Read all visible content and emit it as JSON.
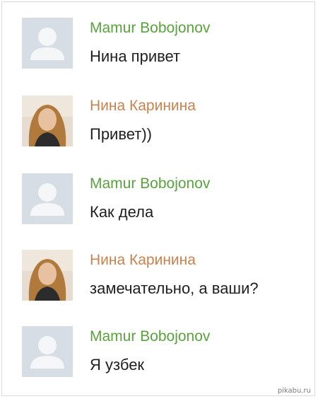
{
  "colors": {
    "name_male": "#58a33c",
    "name_female": "#c9824f",
    "text": "#1f1f1f",
    "avatar_placeholder_bg": "#d6dde5",
    "avatar_placeholder_fg": "#f4f6f8"
  },
  "messages": [
    {
      "author": "Mamur Bobojonov",
      "text": "Нина привет",
      "avatar": "placeholder-user-icon",
      "name_color": "#58a33c"
    },
    {
      "author": "Нина Каринина",
      "text": "Привет))",
      "avatar": "photo",
      "name_color": "#c9824f"
    },
    {
      "author": "Mamur Bobojonov",
      "text": "Как дела",
      "avatar": "placeholder-user-icon",
      "name_color": "#58a33c"
    },
    {
      "author": "Нина Каринина",
      "text": "замечательно, а ваши?",
      "avatar": "photo",
      "name_color": "#c9824f"
    },
    {
      "author": "Mamur Bobojonov",
      "text": "Я узбек",
      "avatar": "placeholder-user-icon",
      "name_color": "#58a33c"
    }
  ],
  "watermark": "pikabu.ru"
}
